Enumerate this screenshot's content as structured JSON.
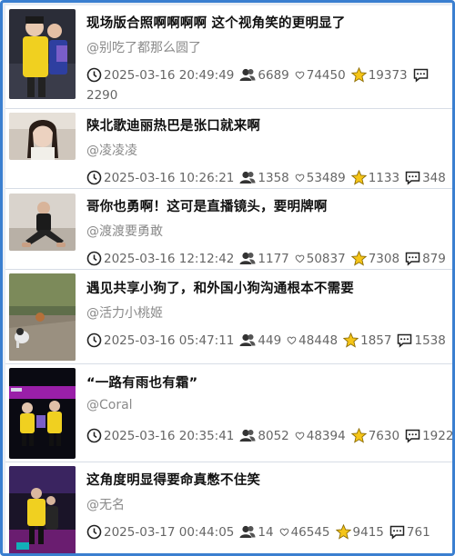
{
  "posts": [
    {
      "title": "现场版合照啊啊啊啊 这个视角笑的更明显了",
      "author": "@别吃了都那么圆了",
      "time": "2025-03-16 20:49:49",
      "views": "6689",
      "likes": "74450",
      "stars": "19373",
      "comments": "2290"
    },
    {
      "title": "陕北歌迪丽热巴是张口就来啊",
      "author": "@凌凌凌",
      "time": "2025-03-16 10:26:21",
      "views": "1358",
      "likes": "53489",
      "stars": "1133",
      "comments": "348"
    },
    {
      "title": "哥你也勇啊！这可是直播镜头，要明牌啊",
      "author": "@渡渡要勇敢",
      "time": "2025-03-16 12:12:42",
      "views": "1177",
      "likes": "50837",
      "stars": "7308",
      "comments": "879"
    },
    {
      "title": "遇见共享小狗了，和外国小狗沟通根本不需要",
      "author": "@活力小桃姬",
      "time": "2025-03-16 05:47:11",
      "views": "449",
      "likes": "48448",
      "stars": "1857",
      "comments": "1538"
    },
    {
      "title": "“一路有雨也有霜”",
      "author": "@Coral",
      "time": "2025-03-16 20:35:41",
      "views": "8052",
      "likes": "48394",
      "stars": "7630",
      "comments": "1922"
    },
    {
      "title": "这角度明显得要命真憋不住笑",
      "author": "@无名",
      "time": "2025-03-17 00:44:05",
      "views": "14",
      "likes": "46545",
      "stars": "9415",
      "comments": "761"
    }
  ],
  "icons": {
    "time": "clock-icon",
    "views": "people-icon",
    "likes": "heart-icon",
    "stars": "star-icon",
    "comments": "comment-icon"
  },
  "colors": {
    "frame_border": "#3a7fd0",
    "star_fill": "#f5c518",
    "title_text": "#111111",
    "meta_text": "#666666"
  }
}
